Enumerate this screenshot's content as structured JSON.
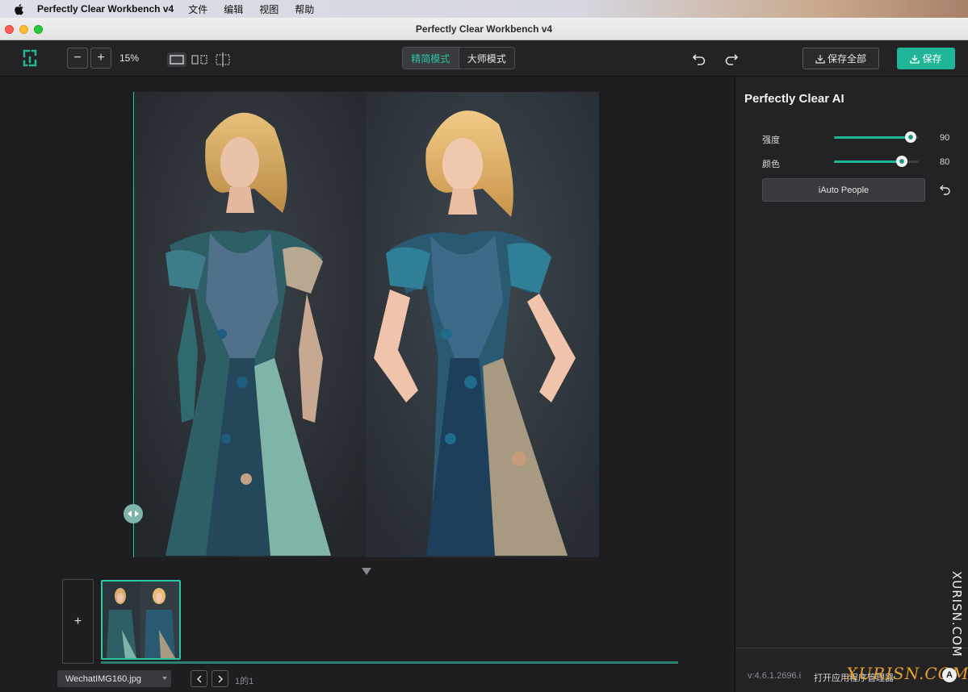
{
  "menubar": {
    "app_name": "Perfectly Clear Workbench v4",
    "items": [
      "文件",
      "编辑",
      "视图",
      "帮助"
    ]
  },
  "window": {
    "title": "Perfectly Clear Workbench v4"
  },
  "toolbar": {
    "zoom_out_label": "−",
    "zoom_in_label": "+",
    "zoom_level": "15%",
    "mode_simple": "精简模式",
    "mode_master": "大师模式",
    "save_all_label": "保存全部",
    "save_label": "保存",
    "accent_color": "#1fb597"
  },
  "canvas": {
    "add_label": "+",
    "file_name": "WechatIMG160.jpg",
    "page_count": "1的1"
  },
  "panel": {
    "title": "Perfectly Clear AI",
    "sliders": [
      {
        "label": "强度",
        "value": "90",
        "level": 0.9
      },
      {
        "label": "颜色",
        "value": "80",
        "level": 0.8
      }
    ],
    "preset_label": "iAuto People",
    "version": "v:4.6.1.2696.i",
    "open_manager": "打开应用程序管理器"
  },
  "watermark": {
    "vertical": "XURISN.COM",
    "horizontal": "XURISN.COM",
    "badge": "A"
  }
}
